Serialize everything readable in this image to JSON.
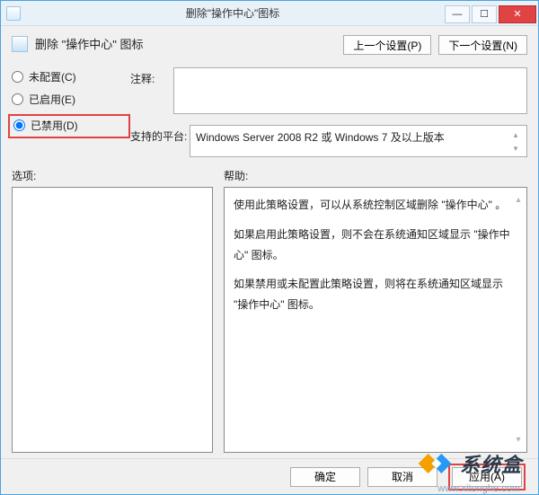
{
  "titlebar": {
    "title": "删除\"操作中心\"图标"
  },
  "headerTitle": "删除 \"操作中心\" 图标",
  "nav": {
    "prev": "上一个设置(P)",
    "next": "下一个设置(N)"
  },
  "radios": {
    "notConfigured": "未配置(C)",
    "enabled": "已启用(E)",
    "disabled": "已禁用(D)"
  },
  "labels": {
    "comment": "注释:",
    "platform": "支持的平台:",
    "options": "选项:",
    "help": "帮助:"
  },
  "platformText": "Windows Server 2008 R2 或 Windows 7 及以上版本",
  "help": {
    "p1": "使用此策略设置，可以从系统控制区域删除 \"操作中心\" 。",
    "p2": "如果启用此策略设置，则不会在系统通知区域显示 \"操作中心\" 图标。",
    "p3": "如果禁用或未配置此策略设置，则将在系统通知区域显示 \"操作中心\" 图标。"
  },
  "footer": {
    "ok": "确定",
    "cancel": "取消",
    "apply": "应用(A)"
  },
  "watermark": {
    "text": "系统盒",
    "url": "www.xitonghe.com"
  }
}
